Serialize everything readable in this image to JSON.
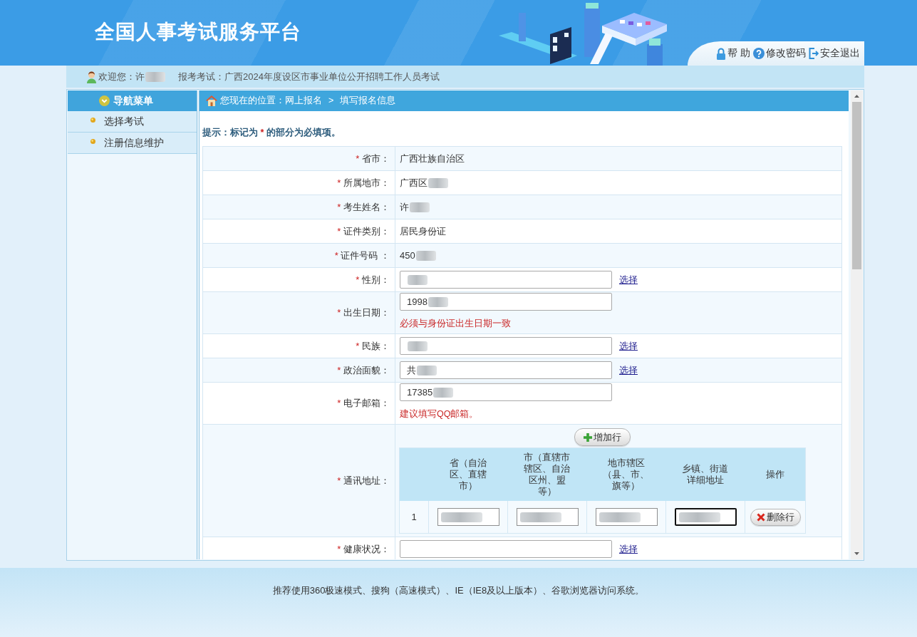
{
  "header": {
    "title": "全国人事考试服务平台",
    "links": [
      {
        "kind": "help",
        "label": "帮 助"
      },
      {
        "kind": "password",
        "label": "修改密码"
      },
      {
        "kind": "logout",
        "label": "安全退出"
      }
    ]
  },
  "welcome_bar": {
    "greeting": "欢迎您：许",
    "greeting_redacted": true,
    "exam": "报考考试：广西2024年度设区市事业单位公开招聘工作人员考试"
  },
  "sidebar": {
    "title": "导航菜单",
    "items": [
      {
        "label": "选择考试"
      },
      {
        "label": "注册信息维护"
      }
    ]
  },
  "breadcrumb": {
    "label": "您现在的位置：",
    "path": [
      "网上报名",
      "填写报名信息"
    ],
    "separator": ">"
  },
  "hint": {
    "before": "提示：标记为",
    "mark": "*",
    "after": "的部分为必填项。"
  },
  "form": {
    "required_mark": "*",
    "rows": [
      {
        "kind": "text",
        "required": true,
        "label": "省市：",
        "value": "广西壮族自治区",
        "redacted": false
      },
      {
        "kind": "text",
        "required": true,
        "label": "所属地市：",
        "value": "广西区",
        "redacted": true
      },
      {
        "kind": "text",
        "required": true,
        "label": "考生姓名：",
        "value": "许",
        "redacted": true
      },
      {
        "kind": "text",
        "required": true,
        "label": "证件类别：",
        "value": "居民身份证",
        "redacted": false
      },
      {
        "kind": "text",
        "required": true,
        "label": "证件号码 ：",
        "value": "450",
        "redacted": true
      },
      {
        "kind": "input",
        "required": true,
        "label": "性别：",
        "redacted": true,
        "link": "选择"
      },
      {
        "kind": "input",
        "required": true,
        "label": "出生日期：",
        "value": "1998",
        "redacted": true,
        "note": "必须与身份证出生日期一致"
      },
      {
        "kind": "input",
        "required": true,
        "label": "民族：",
        "redacted": true,
        "link": "选择"
      },
      {
        "kind": "input",
        "required": true,
        "label": "政治面貌：",
        "value": "共",
        "redacted": true,
        "link": "选择"
      },
      {
        "kind": "input",
        "required": true,
        "label": "电子邮箱：",
        "value": "17385",
        "redacted": true,
        "note": "建议填写QQ邮箱。"
      },
      {
        "kind": "address",
        "required": true,
        "label": "通讯地址：",
        "add_label": "增加行",
        "columns": [
          "省（自治区、直辖市）",
          "市（直辖市辖区、自治区州、盟等）",
          "地市辖区（县、市、旗等）",
          "乡镇、街道详细地址",
          "操作"
        ],
        "rows": [
          {
            "index": "1",
            "cells": [
              {
                "redacted": true,
                "focused": false
              },
              {
                "redacted": true,
                "focused": false
              },
              {
                "redacted": true,
                "focused": false
              },
              {
                "redacted": true,
                "focused": true
              }
            ],
            "delete_label": "删除行"
          }
        ]
      },
      {
        "kind": "input",
        "required": true,
        "label": "健康状况：",
        "redacted": false,
        "link": "选择"
      }
    ]
  },
  "footer": {
    "text": "推荐使用360极速模式、搜狗（高速模式）、IE（IE8及以上版本）、谷歌浏览器访问系统。"
  }
}
